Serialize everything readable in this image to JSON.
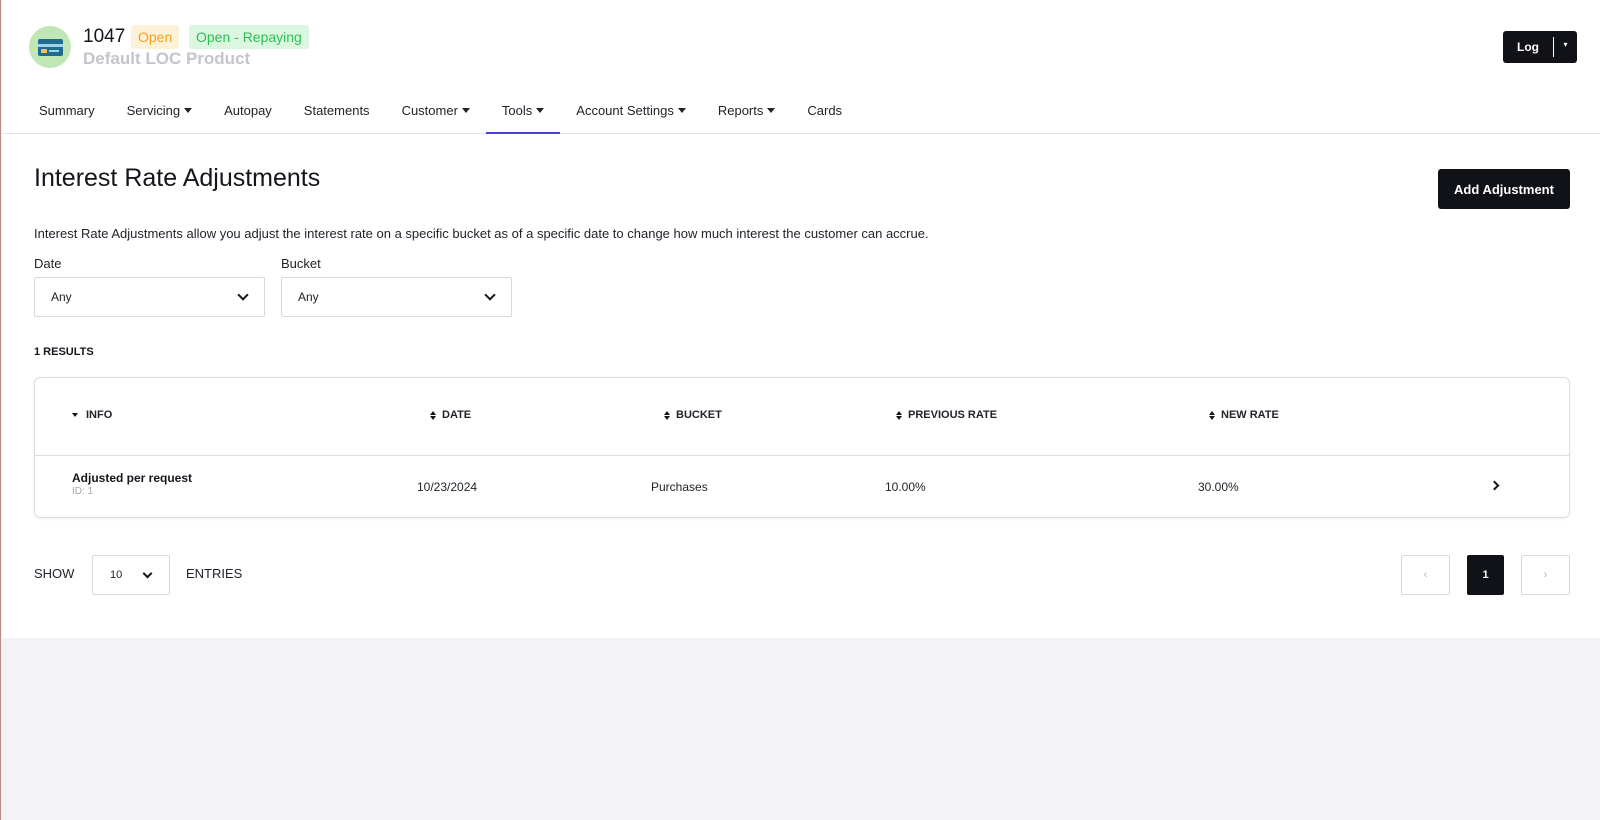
{
  "account": {
    "id": "1047",
    "status_badge": "Open",
    "substatus_badge": "Open - Repaying",
    "product": "Default LOC Product",
    "icon": "credit-card-icon"
  },
  "log_button": {
    "label": "Log"
  },
  "nav": [
    {
      "label": "Summary",
      "dropdown": false,
      "active": false
    },
    {
      "label": "Servicing",
      "dropdown": true,
      "active": false
    },
    {
      "label": "Autopay",
      "dropdown": false,
      "active": false
    },
    {
      "label": "Statements",
      "dropdown": false,
      "active": false
    },
    {
      "label": "Customer",
      "dropdown": true,
      "active": false
    },
    {
      "label": "Tools",
      "dropdown": true,
      "active": true
    },
    {
      "label": "Account Settings",
      "dropdown": true,
      "active": false
    },
    {
      "label": "Reports",
      "dropdown": true,
      "active": false
    },
    {
      "label": "Cards",
      "dropdown": false,
      "active": false
    }
  ],
  "colors": {
    "active_tab": "#4b3fe0",
    "primary_button": "#111217",
    "open_badge": "#f0a020",
    "repaying_badge": "#2ebd55"
  },
  "page": {
    "title": "Interest Rate Adjustments",
    "add_button": "Add Adjustment",
    "description": "Interest Rate Adjustments allow you adjust the interest rate on a specific bucket as of a specific date to change how much interest the customer can accrue."
  },
  "filters": {
    "date": {
      "label": "Date",
      "value": "Any"
    },
    "bucket": {
      "label": "Bucket",
      "value": "Any"
    }
  },
  "results_label": "1 RESULTS",
  "table": {
    "columns": [
      "INFO",
      "DATE",
      "BUCKET",
      "PREVIOUS RATE",
      "NEW RATE"
    ],
    "rows": [
      {
        "info": "Adjusted per request",
        "id_label": "ID: 1",
        "date": "10/23/2024",
        "bucket": "Purchases",
        "previous_rate": "10.00%",
        "new_rate": "30.00%"
      }
    ]
  },
  "pagination": {
    "show_label": "SHOW",
    "page_size": "10",
    "entries_label": "ENTRIES",
    "prev": "‹",
    "current_page": "1",
    "next": "›"
  }
}
